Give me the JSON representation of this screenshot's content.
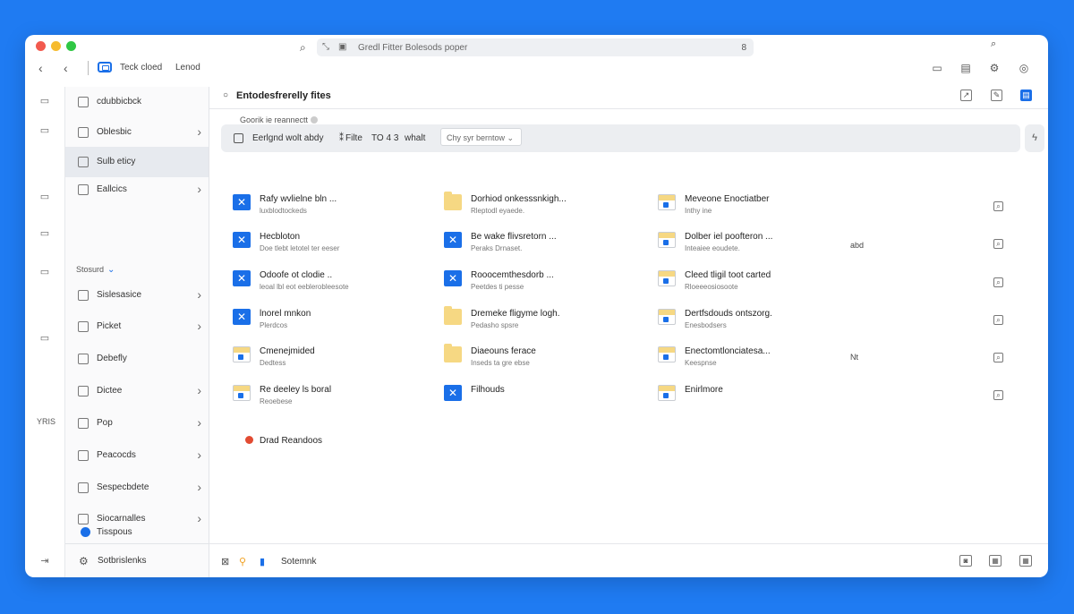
{
  "titlebar": {
    "back_label": "‹",
    "back2_label": "‹",
    "app_title": "Teck cloed",
    "app_subtitle": "Lenod",
    "search_text": "Gredl Fitter Bolesods poper",
    "search_count": "8",
    "icons": [
      "panel-icon",
      "doc-icon",
      "settings-icon",
      "target-icon"
    ]
  },
  "rail": {
    "label": "YRIS"
  },
  "sidebar": {
    "items": [
      {
        "label": "cdubbicbck",
        "chevron": false
      },
      {
        "label": "Oblesbic",
        "chevron": true
      },
      {
        "label": "Sulb eticy",
        "chevron": false,
        "active": true
      },
      {
        "label": "Eallcics",
        "chevron": true
      }
    ],
    "section_label": "Stosurd",
    "items2": [
      {
        "label": "Sislesasice",
        "chevron": true
      },
      {
        "label": "Picket",
        "chevron": true
      },
      {
        "label": "Debefly",
        "chevron": false
      },
      {
        "label": "Dictee",
        "chevron": true
      },
      {
        "label": "Pop",
        "chevron": true
      },
      {
        "label": "Peacocds",
        "chevron": true
      },
      {
        "label": "Sespecbdete",
        "chevron": true
      },
      {
        "label": "Siocarnalles",
        "chevron": true
      },
      {
        "label": "Tisspous",
        "chevron": false
      }
    ],
    "bottom_label": "Sotbrislenks"
  },
  "main": {
    "title": "Entodesfrerelly fites",
    "crumb": "Goorik ie reannectt",
    "filter": {
      "label1": "Eerlgnd wolt abdy",
      "label2": "Filte",
      "count": "TO 4 3",
      "label3": "whalt",
      "select": "Chy syr berntow ⌄"
    },
    "files": [
      [
        {
          "name": "Rafy wvlielne bln ...",
          "sub": "luxblodtockeds",
          "icon": "blue"
        },
        {
          "name": "Dorhiod onkesssnkigh...",
          "sub": "Rleptodl eyaede.",
          "icon": "folder"
        },
        {
          "name": "Meveone Enoctiatber",
          "sub": "Inthy ine",
          "icon": "doc"
        }
      ],
      [
        {
          "name": "Hecbloton",
          "sub": "Doe tlebt letotel ter eeser",
          "icon": "blue"
        },
        {
          "name": "Be wake flivsretorn ...",
          "sub": "Peraks Drnaset.",
          "icon": "blue"
        },
        {
          "name": "Dolber iel poofteron ...",
          "sub": "Inteaiee eoudete.",
          "icon": "doc"
        }
      ],
      [
        {
          "name": "Odoofe ot clodie ..",
          "sub": "leoal lbl eot eeblerobleesote",
          "icon": "blue"
        },
        {
          "name": "Rooocemthesdorb ...",
          "sub": "Peetdes ti pesse",
          "icon": "blue"
        },
        {
          "name": "Cleed tligil toot carted",
          "sub": "Rloeeeosiosoote",
          "icon": "doc"
        }
      ],
      [
        {
          "name": "lnorel mnkon",
          "sub": "Plerdcos",
          "icon": "blue"
        },
        {
          "name": "Dremeke fligyme logh.",
          "sub": "Pedasho spsre",
          "icon": "folder"
        },
        {
          "name": "Dertfsdouds ontszorg.",
          "sub": "Enesbodsers",
          "icon": "doc"
        }
      ],
      [
        {
          "name": "Cmenejmided",
          "sub": "Dedtess",
          "icon": "doc"
        },
        {
          "name": "Diaeouns ferace",
          "sub": "Inseds ta gre ebse",
          "icon": "folder"
        },
        {
          "name": "Enectomtlonciatesa...",
          "sub": "Keespnse",
          "icon": "doc"
        }
      ],
      [
        {
          "name": "Re deeley ls boral",
          "sub": "Reoebese",
          "icon": "doc"
        },
        {
          "name": "Filhouds",
          "sub": "",
          "icon": "blue"
        },
        {
          "name": "Enirlmore",
          "sub": "",
          "icon": "doc"
        }
      ]
    ],
    "row_badges": [
      "",
      "abd",
      "",
      "",
      "Nt",
      ""
    ],
    "pinned": "Drad Reandoos",
    "bottom_label": "Sotemnk"
  }
}
